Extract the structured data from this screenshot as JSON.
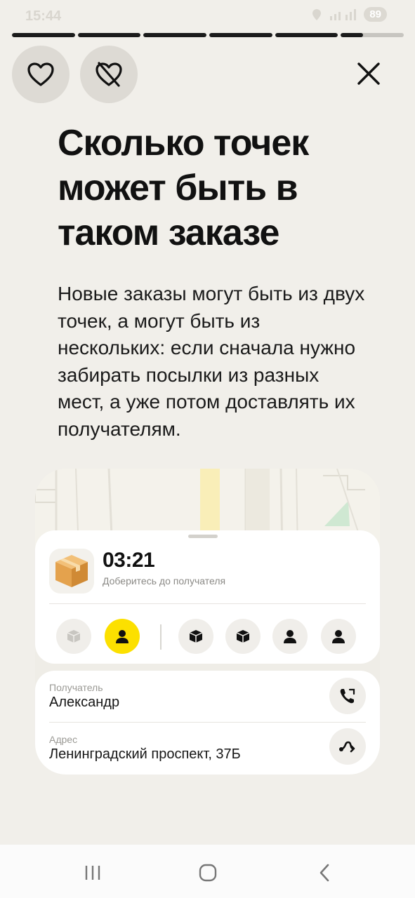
{
  "status_bar": {
    "time": "15:44",
    "battery": "89",
    "icons": [
      "screen-icon",
      "ring-icon",
      "chat-icon",
      "notification-icon",
      "location-icon",
      "signal-icon",
      "battery-icon"
    ]
  },
  "progress": {
    "segments": 6,
    "current_fill": 0.35
  },
  "actions": {
    "like_icon": "heart-icon",
    "dislike_icon": "heart-crossed-icon",
    "close_icon": "close-icon"
  },
  "story": {
    "title": "Сколько точек может быть в таком заказе",
    "description": "Новые заказы могут быть из двух точек, а могут быть из нескольких: если сначала нужно забирать посылки из разных мест, а уже потом доставлять их получателям."
  },
  "order_card": {
    "timer": "03:21",
    "timer_subtitle": "Доберитесь до получателя",
    "stops": [
      {
        "type": "package",
        "state": "done"
      },
      {
        "type": "person",
        "state": "active"
      },
      {
        "type": "package",
        "state": "pending"
      },
      {
        "type": "package",
        "state": "pending"
      },
      {
        "type": "person",
        "state": "pending"
      },
      {
        "type": "person",
        "state": "pending"
      }
    ]
  },
  "recipient": {
    "label": "Получатель",
    "name": "Александр",
    "address_label": "Адрес",
    "address": "Ленинградский проспект, 37Б"
  },
  "colors": {
    "background": "#f1efea",
    "accent": "#fce000",
    "text": "#111111"
  }
}
